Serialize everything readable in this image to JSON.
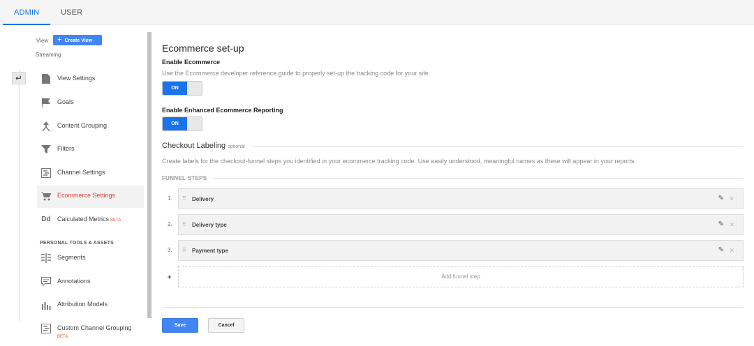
{
  "tabs": {
    "admin": "ADMIN",
    "user": "USER"
  },
  "sidebar": {
    "view_label": "View",
    "create_view": "Create View",
    "streaming": "Streaming",
    "items": [
      {
        "label": "View Settings",
        "icon": "document-icon"
      },
      {
        "label": "Goals",
        "icon": "flag-icon"
      },
      {
        "label": "Content Grouping",
        "icon": "content-grouping-icon"
      },
      {
        "label": "Filters",
        "icon": "filter-icon"
      },
      {
        "label": "Channel Settings",
        "icon": "channel-settings-icon"
      },
      {
        "label": "Ecommerce Settings",
        "icon": "cart-icon",
        "active": true
      },
      {
        "label": "Calculated Metrics",
        "icon": "calculated-metrics-icon",
        "badge": "BETA"
      }
    ],
    "section_header": "PERSONAL TOOLS & ASSETS",
    "personal_items": [
      {
        "label": "Segments",
        "icon": "segments-icon"
      },
      {
        "label": "Annotations",
        "icon": "annotations-icon"
      },
      {
        "label": "Attribution Models",
        "icon": "bar-chart-icon"
      },
      {
        "label": "Custom Channel Grouping",
        "icon": "custom-channel-icon",
        "badge": "BETA"
      }
    ]
  },
  "main": {
    "title": "Ecommerce set-up",
    "enable_ecommerce": {
      "label": "Enable Ecommerce",
      "description": "Use the Ecommerce developer reference guide to properly set-up the tracking code for your site.",
      "toggle": "ON"
    },
    "enhanced": {
      "label": "Enable Enhanced Ecommerce Reporting",
      "toggle": "ON"
    },
    "checkout": {
      "title": "Checkout Labeling",
      "optional": "optional",
      "description": "Create labels for the checkout-funnel steps you identified in your ecommerce tracking code. Use easily understood, meaningful names as these will appear in your reports."
    },
    "funnel_header": "FUNNEL STEPS",
    "steps": [
      {
        "num": "1.",
        "name": "Delivery"
      },
      {
        "num": "2.",
        "name": "Delivery type"
      },
      {
        "num": "3.",
        "name": "Payment type"
      }
    ],
    "add_plus": "+",
    "add_step": "Add funnel step",
    "save": "Save",
    "cancel": "Cancel"
  },
  "colors": {
    "accent": "#1a73e8",
    "active_nav": "#db4437",
    "beta": "#f4511e"
  }
}
